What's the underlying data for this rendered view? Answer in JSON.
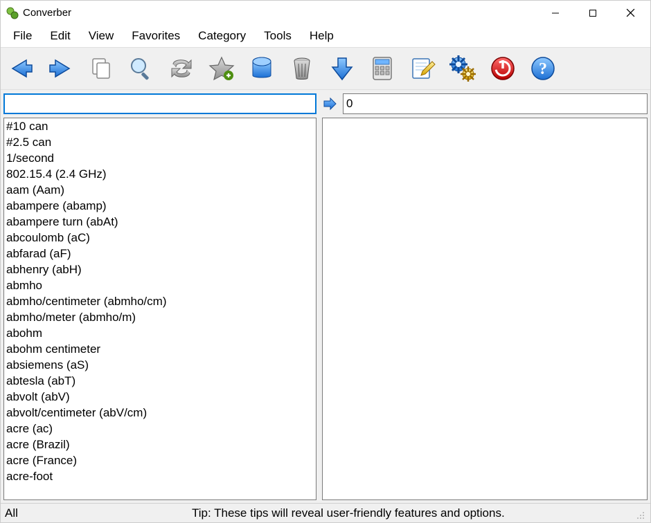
{
  "title": "Converber",
  "menu": [
    "File",
    "Edit",
    "View",
    "Favorites",
    "Category",
    "Tools",
    "Help"
  ],
  "toolbar": [
    {
      "name": "back-icon"
    },
    {
      "name": "forward-icon"
    },
    {
      "name": "copy-icon"
    },
    {
      "name": "search-icon"
    },
    {
      "name": "swap-icon"
    },
    {
      "name": "favorite-add-icon"
    },
    {
      "name": "database-icon"
    },
    {
      "name": "trash-icon"
    },
    {
      "name": "download-icon"
    },
    {
      "name": "calculator-icon"
    },
    {
      "name": "edit-note-icon"
    },
    {
      "name": "settings-icon"
    },
    {
      "name": "power-icon"
    },
    {
      "name": "help-icon"
    }
  ],
  "input": {
    "from_value": "",
    "to_value": "0"
  },
  "units_from": [
    "#10 can",
    "#2.5 can",
    "1/second",
    "802.15.4 (2.4 GHz)",
    "aam (Aam)",
    "abampere (abamp)",
    "abampere turn (abAt)",
    "abcoulomb (aC)",
    "abfarad (aF)",
    "abhenry (abH)",
    "abmho",
    "abmho/centimeter (abmho/cm)",
    "abmho/meter (abmho/m)",
    "abohm",
    "abohm centimeter",
    "absiemens (aS)",
    "abtesla (abT)",
    "abvolt (abV)",
    "abvolt/centimeter (abV/cm)",
    "acre (ac)",
    "acre (Brazil)",
    "acre (France)",
    "acre-foot"
  ],
  "units_to": [],
  "status": {
    "category": "All",
    "tip": "Tip: These tips will reveal user-friendly features and options."
  }
}
